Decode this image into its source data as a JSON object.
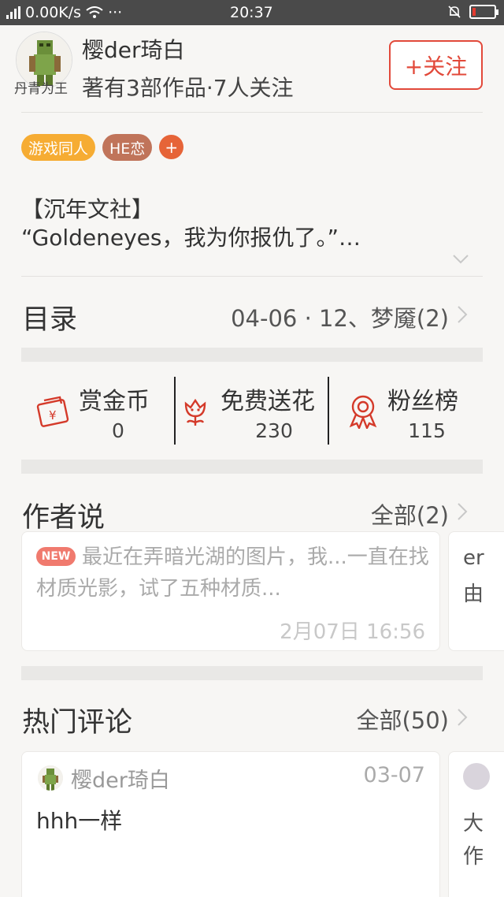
{
  "status_bar": {
    "network": "0.00K/s",
    "more": "···",
    "time": "20:37"
  },
  "author": {
    "name": "樱der琦白",
    "meta": "著有3部作品·7人关注",
    "avatar_overlay": "丹青为王",
    "follow_label": "+关注"
  },
  "tags": [
    {
      "label": "游戏同人",
      "color": "#f6ac33"
    },
    {
      "label": "HE恋",
      "color": "#c0745a"
    }
  ],
  "tag_add": "+",
  "intro": {
    "line1": "【沉年文社】",
    "line2": "“Goldeneyes，我为你报仇了。”…"
  },
  "catalog": {
    "title": "目录",
    "latest": "04-06 · 12、梦魇(2)"
  },
  "stats": [
    {
      "label": "赏金币",
      "value": "0",
      "icon": "red-envelope-icon"
    },
    {
      "label": "免费送花",
      "value": "230",
      "icon": "flower-icon"
    },
    {
      "label": "粉丝榜",
      "value": "115",
      "icon": "ribbon-medal-icon"
    }
  ],
  "author_says": {
    "title": "作者说",
    "more": "全部(2)",
    "note": {
      "badge": "NEW",
      "text": "最近在弄暗光湖的图片，我...一直在找材质光影，试了五种材质...",
      "time": "2月07日  16:56"
    },
    "peek": [
      "er",
      "由"
    ]
  },
  "hot_comments": {
    "title": "热门评论",
    "more": "全部(50)",
    "comment": {
      "user": "樱der琦白",
      "date": "03-07",
      "text": "hhh一样"
    },
    "peek": [
      "大",
      "作"
    ]
  },
  "colors": {
    "accent": "#e2493a",
    "background": "#f7f6f4",
    "band": "#e9e8e6"
  }
}
